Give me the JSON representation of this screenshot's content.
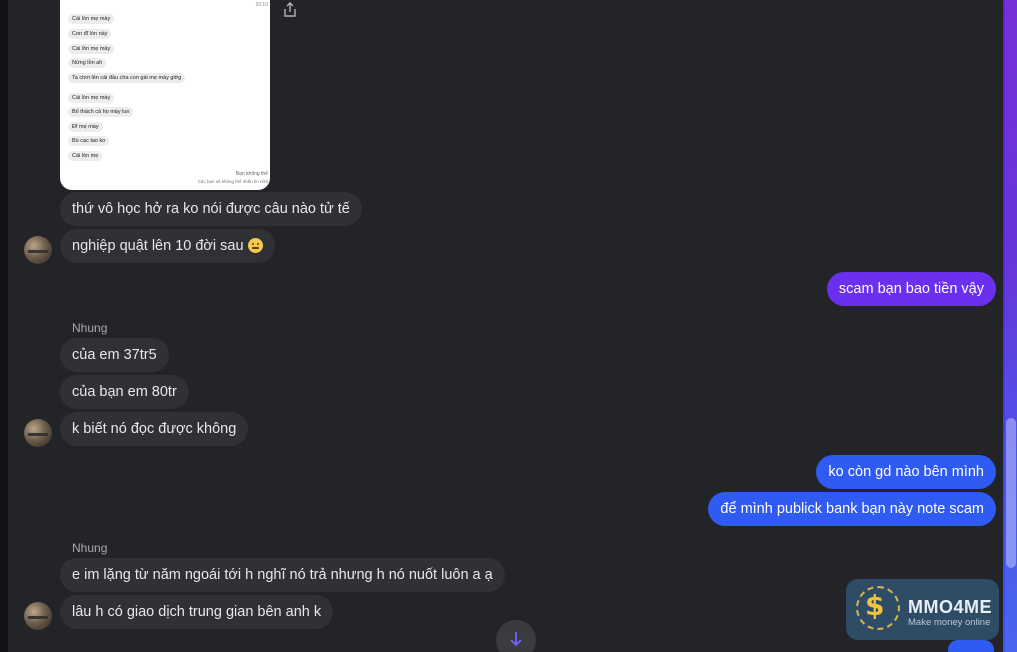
{
  "shared_image": {
    "timestamp": "20:10",
    "lines_group1": [
      "Cái lòn mẹ mày",
      "Con đĩ lòn này",
      "Cái lồn mẹ mày",
      "Nứng lồn ah",
      "Ta chơi lên cái đầu cha con gái mẹ mày giờg"
    ],
    "lines_group2": [
      "Cái lòn mẹ mày",
      "Bố thách cả họ mày lun",
      "Đĩ mẹ mày",
      "Bú cạc tao ko",
      "Cái lòn mẹ"
    ],
    "footer_line1": "Bạn không thể",
    "footer_line2": "Các bạn sẽ không thể nhắn tin nữa"
  },
  "messages": [
    {
      "text": "thứ vô học hở ra ko nói được câu nào tử tế"
    },
    {
      "text": "nghiệp quật lên 10 đời sau"
    },
    {
      "text": "scam bạn bao tiền vậy"
    },
    {
      "sender": "Nhung"
    },
    {
      "text": "của em 37tr5"
    },
    {
      "text": "của bạn em 80tr"
    },
    {
      "text": "k biết nó đọc được không"
    },
    {
      "text": "ko còn gd nào bên mình"
    },
    {
      "text": "để mình publick bank bạn này note scam"
    },
    {
      "sender": "Nhung"
    },
    {
      "text": "e im lặng từ năm ngoái tới h nghĩ nó trả nhưng h nó nuốt luôn a ạ"
    },
    {
      "text": "lâu h có giao dịch trung gian bên anh k"
    }
  ],
  "watermark": {
    "brand": "MMO4ME",
    "tagline": "Make money online",
    "symbol": "$"
  },
  "icons": {
    "share": "share-icon",
    "scroll_down": "arrow-down-icon",
    "emoji": "smiling-face-icon"
  },
  "colors": {
    "background": "#232427",
    "incoming_bubble": "#303134",
    "outgoing_purple": "#6b2ff0",
    "outgoing_blue": "#2f5bf2"
  }
}
